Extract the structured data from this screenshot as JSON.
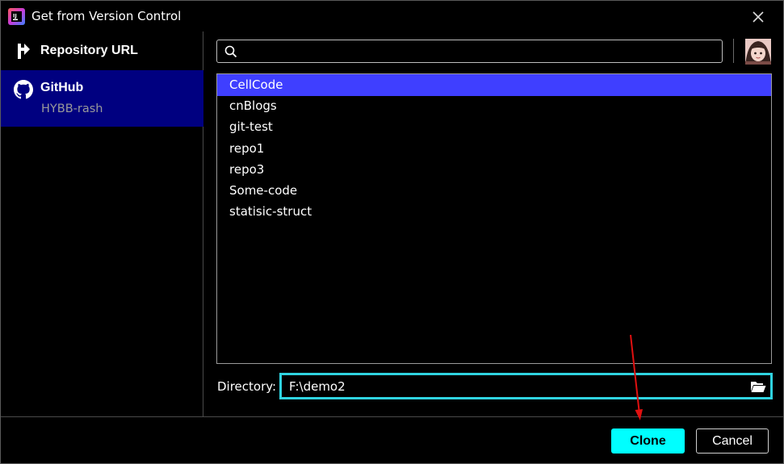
{
  "window": {
    "title": "Get from Version Control"
  },
  "sidebar": {
    "items": [
      {
        "label": "Repository URL",
        "icon": "vcs-upload-icon"
      },
      {
        "label": "GitHub",
        "sublabel": "HYBB-rash",
        "icon": "github-icon",
        "selected": true
      }
    ]
  },
  "search": {
    "value": "",
    "placeholder": ""
  },
  "repositories": [
    "CellCode",
    "cnBlogs",
    "git-test",
    "repo1",
    "repo3",
    "Some-code",
    "statisic-struct"
  ],
  "selected_repository": "CellCode",
  "directory": {
    "label": "Directory:",
    "value": "F:\\demo2"
  },
  "buttons": {
    "clone": "Clone",
    "cancel": "Cancel"
  },
  "colors": {
    "selection": "#3f3fff",
    "sidebar_selected": "#000080",
    "focus_border": "#2fd3e0",
    "primary_button": "#00ffff",
    "annotation_arrow": "#e01010"
  }
}
